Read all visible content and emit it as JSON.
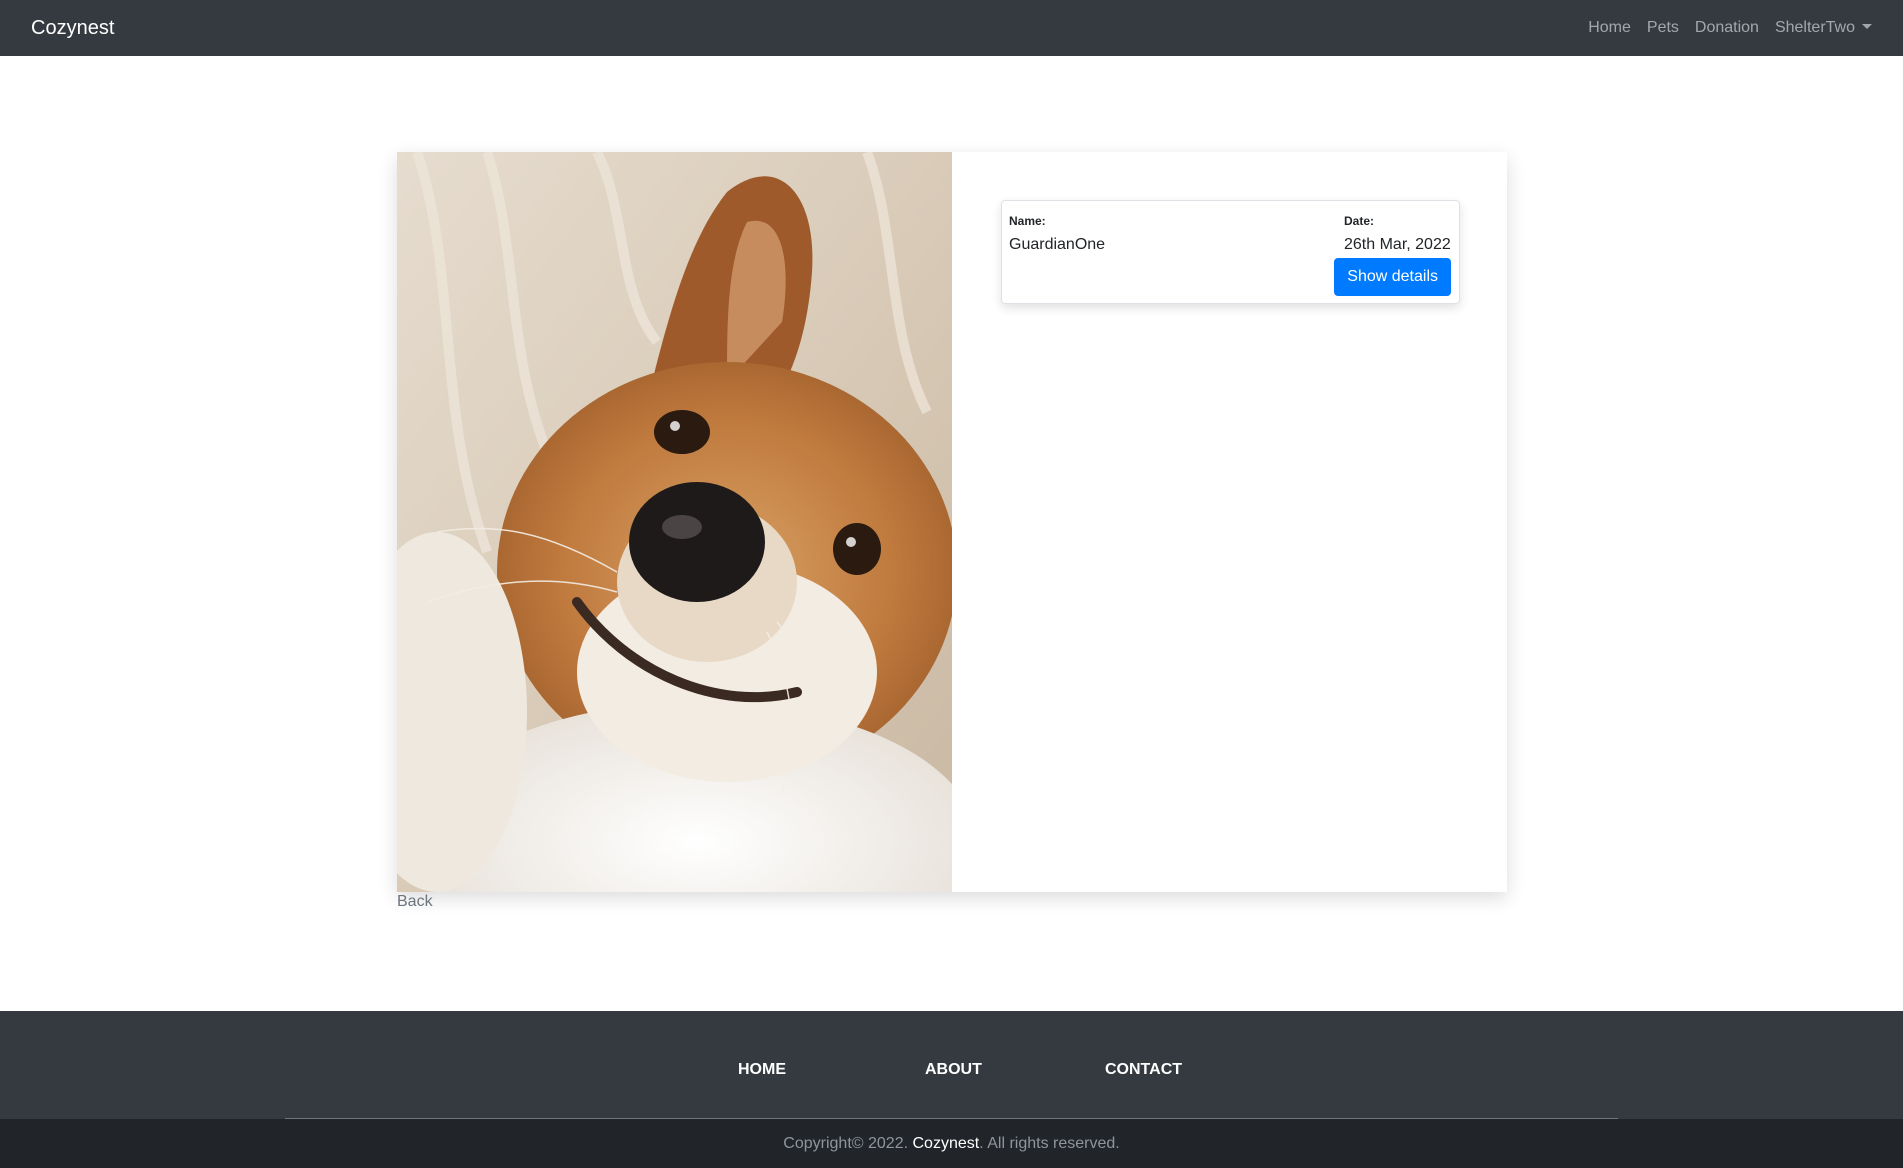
{
  "navbar": {
    "brand": "Cozynest",
    "links": [
      "Home",
      "Pets",
      "Donation"
    ],
    "user_menu": "ShelterTwo"
  },
  "pet": {
    "photo_alt": "dog"
  },
  "adoption": {
    "name_label": "Name:",
    "name_value": "GuardianOne",
    "date_label": "Date:",
    "date_value": "26th Mar, 2022",
    "details_button": "Show details"
  },
  "back_link": "Back",
  "footer": {
    "links": [
      "HOME",
      "ABOUT",
      "CONTACT"
    ],
    "copyright_prefix": "Copyright© 2022.",
    "copyright_brand": "Cozynest",
    "copyright_suffix": ". All rights reserved."
  },
  "colors": {
    "navbar_bg": "#343a40",
    "footer_bottom_bg": "#212529",
    "primary": "#007bff"
  }
}
